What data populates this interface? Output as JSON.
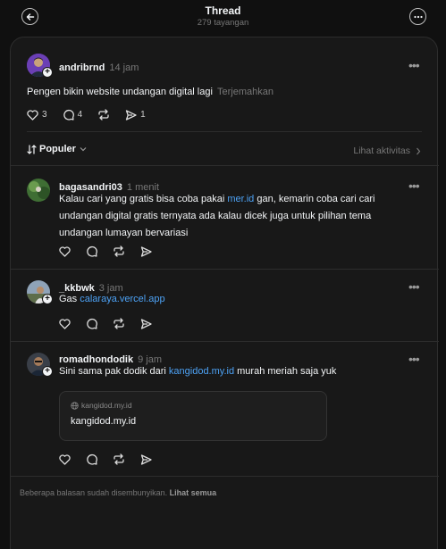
{
  "header": {
    "title": "Thread",
    "views": "279 tayangan"
  },
  "post": {
    "username": "andribrnd",
    "time": "14 jam",
    "text": "Pengen bikin website undangan digital lagi",
    "translate": "Terjemahkan",
    "likes": "3",
    "replies": "4",
    "shares": "1"
  },
  "sort": {
    "label": "Populer",
    "activity": "Lihat aktivitas"
  },
  "replies": [
    {
      "username": "bagasandri03",
      "time": "1 menit",
      "text_before": "Kalau cari yang gratis bisa coba pakai ",
      "link": "mer.id",
      "text_after": " gan, kemarin coba cari cari undangan digital gratis ternyata ada kalau dicek juga untuk pilihan tema undangan lumayan bervariasi"
    },
    {
      "username": "_kkbwk",
      "time": "3 jam",
      "text_before": "Gas ",
      "link": "calaraya.vercel.app",
      "text_after": ""
    },
    {
      "username": "romadhondodik",
      "time": "9 jam",
      "text_before": "Sini sama pak dodik dari ",
      "link": "kangidod.my.id",
      "text_after": " murah meriah saja yuk",
      "preview": {
        "domain": "kangidod.my.id",
        "title": "kangidod.my.id"
      }
    }
  ],
  "footer": {
    "text": "Beberapa balasan sudah disembunyikan.",
    "link": "Lihat semua"
  },
  "colors": {
    "background": "#101010",
    "card": "#181818",
    "link": "#4da2f5",
    "muted": "#777777"
  }
}
